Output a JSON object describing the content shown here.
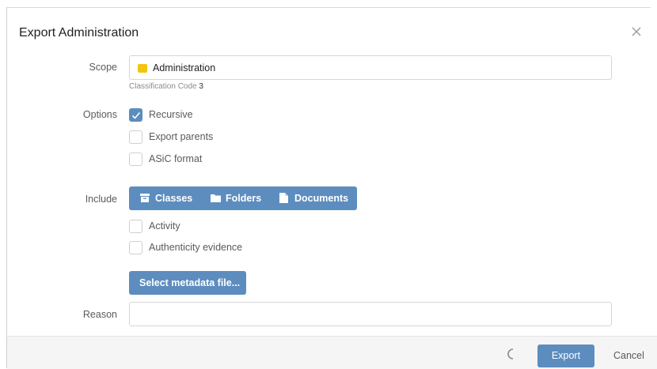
{
  "dialog": {
    "title": "Export Administration"
  },
  "scope": {
    "label": "Scope",
    "value": "Administration",
    "hint_prefix": "Classification Code",
    "hint_code": "3",
    "icon": "folder-yellow-icon",
    "icon_color": "#f2c50e"
  },
  "options": {
    "label": "Options",
    "items": [
      {
        "label": "Recursive",
        "checked": true
      },
      {
        "label": "Export parents",
        "checked": false
      },
      {
        "label": "ASiC format",
        "checked": false
      }
    ]
  },
  "include": {
    "label": "Include",
    "buttons": [
      {
        "label": "Classes",
        "icon": "archive-box-icon"
      },
      {
        "label": "Folders",
        "icon": "folder-icon"
      },
      {
        "label": "Documents",
        "icon": "document-icon"
      }
    ],
    "checkboxes": [
      {
        "label": "Activity",
        "checked": false
      },
      {
        "label": "Authenticity evidence",
        "checked": false
      }
    ],
    "metadata_button": "Select metadata file..."
  },
  "reason": {
    "label": "Reason",
    "value": ""
  },
  "footer": {
    "export_label": "Export",
    "cancel_label": "Cancel"
  },
  "colors": {
    "accent": "#5d8dbf",
    "footer_bg": "#f5f5f5"
  }
}
